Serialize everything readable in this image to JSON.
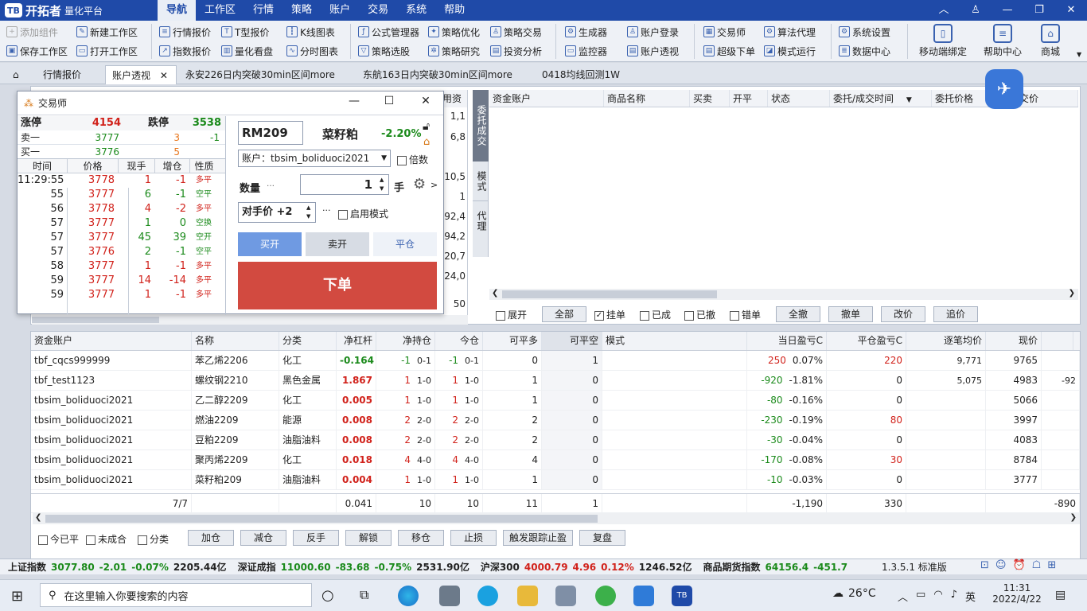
{
  "app": {
    "logo": "开拓者",
    "logo_sub": "量化平台",
    "logo_icon": "TB"
  },
  "menu": [
    "导航",
    "工作区",
    "行情",
    "策略",
    "账户",
    "交易",
    "系统",
    "帮助"
  ],
  "toolbar": {
    "col1": [
      "添加组件",
      "保存工作区"
    ],
    "col2": [
      "新建工作区",
      "打开工作区"
    ],
    "col3": [
      "行情报价",
      "指数报价"
    ],
    "col4": [
      "T型报价",
      "量化看盘"
    ],
    "col5": [
      "K线图表",
      "分时图表"
    ],
    "col6": [
      "公式管理器",
      "策略选股"
    ],
    "col7": [
      "策略优化",
      "策略研究"
    ],
    "col8": [
      "策略交易",
      "投资分析"
    ],
    "col9": [
      "生成器",
      "监控器"
    ],
    "col10": [
      "账户登录",
      "账户透视"
    ],
    "col11": [
      "交易师",
      "超级下单"
    ],
    "col12": [
      "算法代理",
      "模式运行"
    ],
    "col13": [
      "系统设置",
      "数据中心"
    ],
    "big": [
      "移动端绑定",
      "帮助中心",
      "商城"
    ]
  },
  "tabs": [
    "行情报价",
    "账户透视",
    "永安226日内突破30min区间more",
    "东航163日内突破30min区间more",
    "0418均线回测1W"
  ],
  "order_panel": {
    "headers": [
      "资金账户",
      "商品名称",
      "买卖",
      "开平",
      "状态",
      "委托/成交时间",
      "委托价格",
      "成交价"
    ],
    "side_tabs": [
      "委托成交",
      "模式",
      "代理"
    ],
    "filters": [
      "展开",
      "全部",
      "挂单",
      "已成",
      "已撤",
      "错单"
    ],
    "buttons": [
      "全撤",
      "撤单",
      "改价",
      "追价"
    ],
    "partial_left": [
      "用资",
      "1,1",
      "6,8",
      "10,5",
      "1",
      "292,4",
      "94,2",
      "20,7",
      "924,0",
      "50"
    ]
  },
  "trader": {
    "title": "交易师",
    "limit_up_label": "涨停",
    "limit_up": "4154",
    "limit_down_label": "跌停",
    "limit_down": "3538",
    "ask_label": "卖一",
    "ask_price": "3777",
    "ask_vol": "3",
    "ask_chg": "-1",
    "bid_label": "买一",
    "bid_price": "3776",
    "bid_vol": "5",
    "tick_headers": [
      "时间",
      "价格",
      "现手",
      "增仓",
      "性质"
    ],
    "ticks": [
      [
        "11:29:55",
        "3778",
        "1",
        "-1",
        "多平",
        "r"
      ],
      [
        "55",
        "3777",
        "6",
        "-1",
        "空平",
        "g"
      ],
      [
        "56",
        "3778",
        "4",
        "-2",
        "多平",
        "r"
      ],
      [
        "57",
        "3777",
        "1",
        "0",
        "空换",
        "g"
      ],
      [
        "57",
        "3777",
        "45",
        "39",
        "空开",
        "g"
      ],
      [
        "57",
        "3776",
        "2",
        "-1",
        "空平",
        "g"
      ],
      [
        "58",
        "3777",
        "1",
        "-1",
        "多平",
        "r"
      ],
      [
        "59",
        "3777",
        "14",
        "-14",
        "多平",
        "r"
      ],
      [
        "59",
        "3777",
        "1",
        "-1",
        "多平",
        "r"
      ]
    ],
    "symbol": "RM209",
    "symbol_name": "菜籽粕",
    "change": "-2.20%",
    "account": "账户：tbsim_boliduoci2021",
    "multiple": "倍数",
    "qty_label": "数量",
    "qty": "1",
    "qty_unit": "手",
    "price_type": "对手价 +2",
    "enable_mode": "启用模式",
    "buy_open": "买开",
    "sell_open": "卖开",
    "close": "平仓",
    "submit": "下单"
  },
  "positions": {
    "headers": [
      "资金账户",
      "名称",
      "分类",
      "净杠杆",
      "净持仓",
      "今仓",
      "可平多",
      "可平空",
      "模式",
      "当日盈亏C",
      "平仓盈亏C",
      "逐笔均价",
      "现价"
    ],
    "rows": [
      {
        "acct": "tbf_cqcs999999",
        "name": "苯乙烯2206",
        "cat": "化工",
        "lev": "-0.164",
        "net": "-1",
        "netd": "0-1",
        "today": "-1",
        "todayd": "0-1",
        "long": "0",
        "short": "1",
        "pnl": "250",
        "pnlp": "0.07%",
        "close": "220",
        "avg": "9,771",
        "price": "9765",
        "neg": true
      },
      {
        "acct": "tbf_test1123",
        "name": "螺纹钢2210",
        "cat": "黑色金属",
        "lev": "1.867",
        "net": "1",
        "netd": "1-0",
        "today": "1",
        "todayd": "1-0",
        "long": "1",
        "short": "0",
        "pnl": "-920",
        "pnlp": "-1.81%",
        "close": "0",
        "avg": "5,075",
        "price": "4983",
        "extra": "-92"
      },
      {
        "acct": "tbsim_boliduoci2021",
        "name": "乙二醇2209",
        "cat": "化工",
        "lev": "0.005",
        "net": "1",
        "netd": "1-0",
        "today": "1",
        "todayd": "1-0",
        "long": "1",
        "short": "0",
        "pnl": "-80",
        "pnlp": "-0.16%",
        "close": "0",
        "avg": "",
        "price": "5066"
      },
      {
        "acct": "tbsim_boliduoci2021",
        "name": "燃油2209",
        "cat": "能源",
        "lev": "0.008",
        "net": "2",
        "netd": "2-0",
        "today": "2",
        "todayd": "2-0",
        "long": "2",
        "short": "0",
        "pnl": "-230",
        "pnlp": "-0.19%",
        "close": "80",
        "avg": "",
        "price": "3997"
      },
      {
        "acct": "tbsim_boliduoci2021",
        "name": "豆粕2209",
        "cat": "油脂油料",
        "lev": "0.008",
        "net": "2",
        "netd": "2-0",
        "today": "2",
        "todayd": "2-0",
        "long": "2",
        "short": "0",
        "pnl": "-30",
        "pnlp": "-0.04%",
        "close": "0",
        "avg": "",
        "price": "4083"
      },
      {
        "acct": "tbsim_boliduoci2021",
        "name": "聚丙烯2209",
        "cat": "化工",
        "lev": "0.018",
        "net": "4",
        "netd": "4-0",
        "today": "4",
        "todayd": "4-0",
        "long": "4",
        "short": "0",
        "pnl": "-170",
        "pnlp": "-0.08%",
        "close": "30",
        "avg": "",
        "price": "8784"
      },
      {
        "acct": "tbsim_boliduoci2021",
        "name": "菜籽粕209",
        "cat": "油脂油料",
        "lev": "0.004",
        "net": "1",
        "netd": "1-0",
        "today": "1",
        "todayd": "1-0",
        "long": "1",
        "short": "0",
        "pnl": "-10",
        "pnlp": "-0.03%",
        "close": "0",
        "avg": "",
        "price": "3777"
      }
    ],
    "total": {
      "count": "7/7",
      "lev": "0.041",
      "net": "10",
      "today": "10",
      "long": "11",
      "short": "1",
      "pnl": "-1,190",
      "close": "330",
      "extra": "-890"
    },
    "filters": [
      "今已平",
      "未成合",
      "分类"
    ],
    "buttons": [
      "加仓",
      "减仓",
      "反手",
      "解锁",
      "移仓",
      "止损",
      "触发跟踪止盈",
      "复盘"
    ]
  },
  "status": {
    "items": [
      {
        "n": "上证指数",
        "v": "3077.80",
        "c": "-2.01",
        "p": "-0.07%",
        "a": "2205.44亿",
        "col": "g"
      },
      {
        "n": "深证成指",
        "v": "11000.60",
        "c": "-83.68",
        "p": "-0.75%",
        "a": "2531.90亿",
        "col": "g"
      },
      {
        "n": "沪深300",
        "v": "4000.79",
        "c": "4.96",
        "p": "0.12%",
        "a": "1246.52亿",
        "col": "r"
      },
      {
        "n": "商品期货指数",
        "v": "64156.4",
        "c": "-451.7",
        "p": "",
        "a": "",
        "col": "g"
      }
    ],
    "version": "1.3.5.1 标准版"
  },
  "taskbar": {
    "search_placeholder": "在这里输入你要搜索的内容",
    "weather": "26°C",
    "ime": "英",
    "time": "11:31",
    "date": "2022/4/22"
  }
}
